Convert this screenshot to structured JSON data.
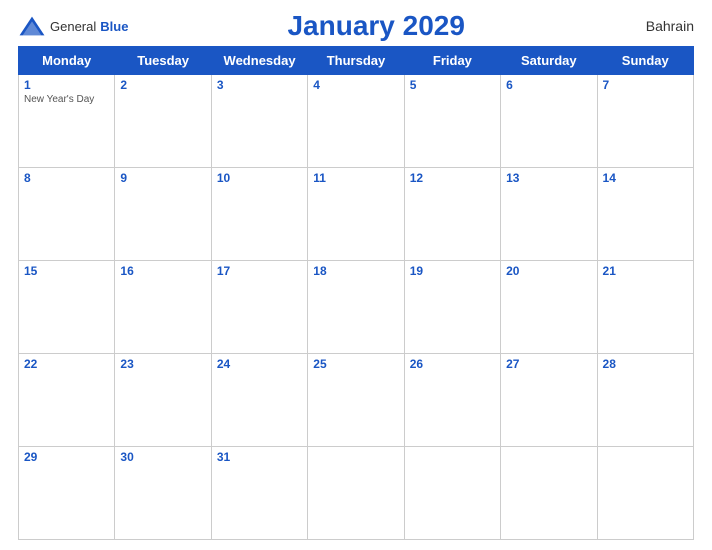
{
  "header": {
    "title": "January 2029",
    "country": "Bahrain",
    "logo_general": "General",
    "logo_blue": "Blue"
  },
  "days_of_week": [
    "Monday",
    "Tuesday",
    "Wednesday",
    "Thursday",
    "Friday",
    "Saturday",
    "Sunday"
  ],
  "weeks": [
    [
      {
        "day": "1",
        "holiday": "New Year's Day"
      },
      {
        "day": "2",
        "holiday": ""
      },
      {
        "day": "3",
        "holiday": ""
      },
      {
        "day": "4",
        "holiday": ""
      },
      {
        "day": "5",
        "holiday": ""
      },
      {
        "day": "6",
        "holiday": ""
      },
      {
        "day": "7",
        "holiday": ""
      }
    ],
    [
      {
        "day": "8",
        "holiday": ""
      },
      {
        "day": "9",
        "holiday": ""
      },
      {
        "day": "10",
        "holiday": ""
      },
      {
        "day": "11",
        "holiday": ""
      },
      {
        "day": "12",
        "holiday": ""
      },
      {
        "day": "13",
        "holiday": ""
      },
      {
        "day": "14",
        "holiday": ""
      }
    ],
    [
      {
        "day": "15",
        "holiday": ""
      },
      {
        "day": "16",
        "holiday": ""
      },
      {
        "day": "17",
        "holiday": ""
      },
      {
        "day": "18",
        "holiday": ""
      },
      {
        "day": "19",
        "holiday": ""
      },
      {
        "day": "20",
        "holiday": ""
      },
      {
        "day": "21",
        "holiday": ""
      }
    ],
    [
      {
        "day": "22",
        "holiday": ""
      },
      {
        "day": "23",
        "holiday": ""
      },
      {
        "day": "24",
        "holiday": ""
      },
      {
        "day": "25",
        "holiday": ""
      },
      {
        "day": "26",
        "holiday": ""
      },
      {
        "day": "27",
        "holiday": ""
      },
      {
        "day": "28",
        "holiday": ""
      }
    ],
    [
      {
        "day": "29",
        "holiday": ""
      },
      {
        "day": "30",
        "holiday": ""
      },
      {
        "day": "31",
        "holiday": ""
      },
      {
        "day": "",
        "holiday": ""
      },
      {
        "day": "",
        "holiday": ""
      },
      {
        "day": "",
        "holiday": ""
      },
      {
        "day": "",
        "holiday": ""
      }
    ]
  ]
}
